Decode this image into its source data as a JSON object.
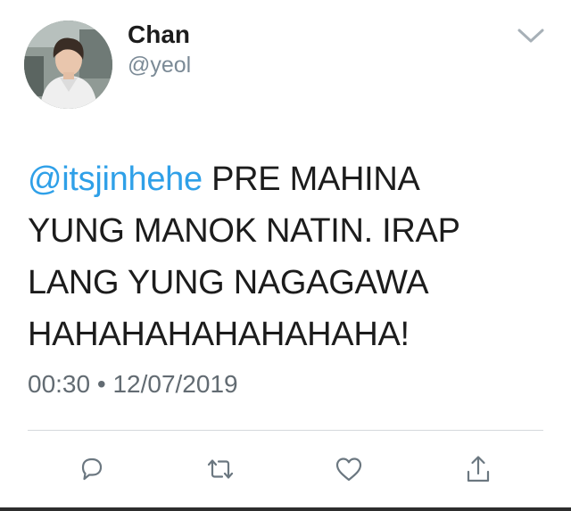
{
  "tweet": {
    "author_name": "Chan",
    "author_handle": "@yeol",
    "mention": "@itsjinhehe",
    "body_lines": [
      " PRE MAHINA",
      "YUNG MANOK NATIN. IRAP",
      "LANG YUNG NAGAGAWA",
      "HAHAHAHAHAHAHAHA!"
    ],
    "time": "00:30",
    "separator": "•",
    "date": "12/07/2019"
  },
  "actions": [
    {
      "icon": "reply-icon"
    },
    {
      "icon": "retweet-icon"
    },
    {
      "icon": "like-icon"
    },
    {
      "icon": "share-icon"
    }
  ],
  "colors": {
    "mention": "#2fa0e8",
    "text": "#1c1c1c",
    "muted": "#7b8a96",
    "icon": "#6b7780",
    "divider": "#d5d9dc"
  }
}
